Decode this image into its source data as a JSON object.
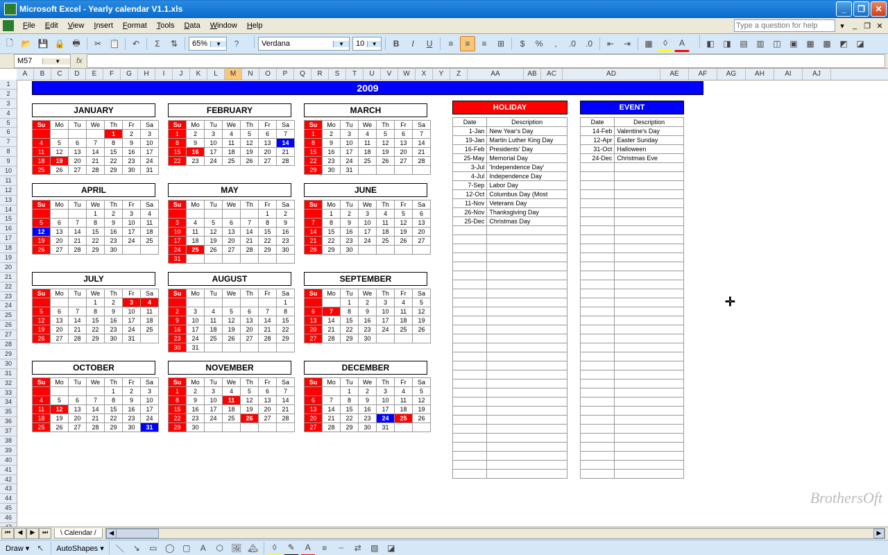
{
  "title_bar": "Microsoft Excel - Yearly calendar V1.1.xls",
  "menu": [
    "File",
    "Edit",
    "View",
    "Insert",
    "Format",
    "Tools",
    "Data",
    "Window",
    "Help"
  ],
  "help_placeholder": "Type a question for help",
  "zoom": "65%",
  "font_name": "Verdana",
  "font_size": "10",
  "name_box": "M57",
  "active_col": "M",
  "year": "2009",
  "holiday_label": "HOLIDAY",
  "event_label": "EVENT",
  "side_headers": [
    "Date",
    "Description"
  ],
  "sheet_tab": "Calendar",
  "draw_label": "Draw",
  "autoshapes_label": "AutoShapes",
  "watermark": "BrothersOft",
  "months": [
    {
      "name": "JANUARY",
      "offset": 4,
      "days": 31,
      "hl": [
        1,
        19
      ],
      "ev": []
    },
    {
      "name": "FEBRUARY",
      "offset": 0,
      "days": 28,
      "hl": [
        16
      ],
      "ev": [
        14
      ]
    },
    {
      "name": "MARCH",
      "offset": 0,
      "days": 31,
      "hl": [],
      "ev": []
    },
    {
      "name": "APRIL",
      "offset": 3,
      "days": 30,
      "hl": [],
      "ev": [
        12
      ]
    },
    {
      "name": "MAY",
      "offset": 5,
      "days": 31,
      "hl": [
        25
      ],
      "ev": []
    },
    {
      "name": "JUNE",
      "offset": 1,
      "days": 30,
      "hl": [],
      "ev": []
    },
    {
      "name": "JULY",
      "offset": 3,
      "days": 31,
      "hl": [
        3,
        4
      ],
      "ev": []
    },
    {
      "name": "AUGUST",
      "offset": 6,
      "days": 31,
      "hl": [],
      "ev": []
    },
    {
      "name": "SEPTEMBER",
      "offset": 2,
      "days": 30,
      "hl": [
        7
      ],
      "ev": []
    },
    {
      "name": "OCTOBER",
      "offset": 4,
      "days": 31,
      "hl": [
        12
      ],
      "ev": [
        31
      ]
    },
    {
      "name": "NOVEMBER",
      "offset": 0,
      "days": 30,
      "hl": [
        11,
        26
      ],
      "ev": []
    },
    {
      "name": "DECEMBER",
      "offset": 2,
      "days": 31,
      "hl": [
        25
      ],
      "ev": [
        24
      ]
    }
  ],
  "day_heads": [
    "Su",
    "Mo",
    "Tu",
    "We",
    "Th",
    "Fr",
    "Sa"
  ],
  "holidays": [
    {
      "d": "1-Jan",
      "t": "New Year's Day"
    },
    {
      "d": "19-Jan",
      "t": "Martin Luther King Day"
    },
    {
      "d": "16-Feb",
      "t": "Presidents' Day"
    },
    {
      "d": "25-May",
      "t": "Memorial Day"
    },
    {
      "d": "3-Jul",
      "t": "'Independence Day'"
    },
    {
      "d": "4-Jul",
      "t": "Independence Day"
    },
    {
      "d": "7-Sep",
      "t": "Labor Day"
    },
    {
      "d": "12-Oct",
      "t": "Columbus Day (Most"
    },
    {
      "d": "11-Nov",
      "t": "Veterans Day"
    },
    {
      "d": "26-Nov",
      "t": "Thanksgiving Day"
    },
    {
      "d": "25-Dec",
      "t": "Christmas Day"
    }
  ],
  "events": [
    {
      "d": "14-Feb",
      "t": "Valentine's Day"
    },
    {
      "d": "12-Apr",
      "t": "Easter Sunday"
    },
    {
      "d": "31-Oct",
      "t": "Halloween"
    },
    {
      "d": "24-Dec",
      "t": "Christmas Eve"
    }
  ],
  "col_widths_narrow": 16,
  "columns": [
    "A",
    "B",
    "C",
    "D",
    "E",
    "F",
    "G",
    "H",
    "I",
    "J",
    "K",
    "L",
    "M",
    "N",
    "O",
    "P",
    "Q",
    "R",
    "S",
    "T",
    "U",
    "V",
    "W",
    "X",
    "Y",
    "Z",
    "AA",
    "AB",
    "AC",
    "AD",
    "AE",
    "AF",
    "AG",
    "AH",
    "AI",
    "AJ"
  ]
}
